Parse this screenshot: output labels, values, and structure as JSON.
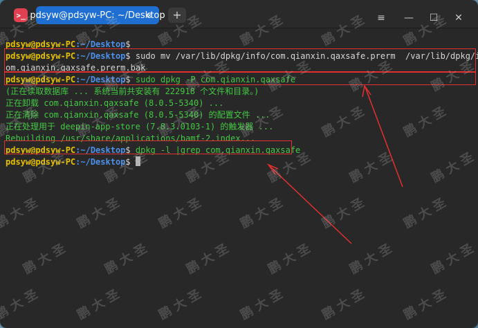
{
  "window": {
    "tab_title": "pdsyw@pdsyw-PC: ~/Desktop",
    "tab_close": "⊗",
    "add_tab": "+",
    "menu_icon": "≡",
    "minimize_icon": "—",
    "maximize_icon": "☐",
    "close_icon": "✕",
    "app_icon_glyph": ">_"
  },
  "terminal": {
    "user": "pdsyw@pdsyw-PC",
    "path": ":~/Desktop",
    "prompt_symbol": "$",
    "lines": {
      "l1_cmd": "",
      "l2_cmd": " sudo mv /var/lib/dpkg/info/com.qianxin.qaxsafe.prerm  /var/lib/dpkg/info/c",
      "l3_cont": "om.qianxin.qaxsafe.prerm.bak",
      "l4_cmd": " sudo dpkg -P com.qianxin.qaxsafe",
      "l5_out": "(正在读取数据库 ... 系统当前共安装有 222918 个文件和目录。)",
      "l6_out": "正在卸载 com.qianxin.qaxsafe (8.0.5-5340) ...",
      "l7_out": "正在清除 com.qianxin.qaxsafe (8.0.5-5340) 的配置文件 ...",
      "l8_out": "正在处理用于 deepin-app-store (7.8.3.0103-1) 的触发器 ...",
      "l9_out": "Rebuilding /usr/share/applications/bamf-2.index...",
      "l10_cmd": " dpkg -l |grep com.qianxin.qaxsafe",
      "l11_cmd": " "
    }
  },
  "watermark_text": "鹏 大 圣",
  "colors": {
    "user": "#e5c100",
    "path": "#4c90e8",
    "output_green": "#43c843",
    "highlight_red": "#e03030",
    "tab_blue": "#1e6fd1"
  }
}
